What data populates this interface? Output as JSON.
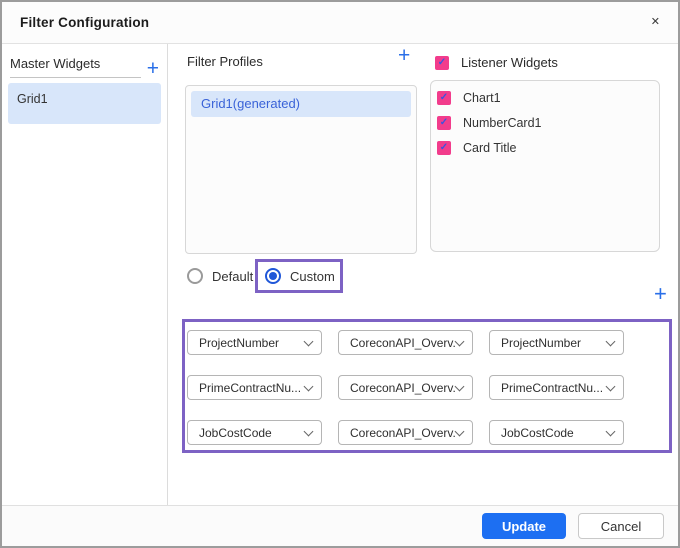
{
  "dialog": {
    "title": "Filter Configuration"
  },
  "icons": {
    "close": "✕",
    "plus": "+",
    "check": "✓"
  },
  "master_widgets": {
    "header": "Master Widgets",
    "items": [
      {
        "label": "Grid1",
        "selected": true
      }
    ]
  },
  "filter_profiles": {
    "header": "Filter Profiles",
    "items": [
      {
        "label": "Grid1(generated)",
        "selected": true
      }
    ]
  },
  "listener_widgets": {
    "header": "Listener Widgets",
    "header_checked": true,
    "items": [
      {
        "label": "Chart1",
        "checked": true
      },
      {
        "label": "NumberCard1",
        "checked": true
      },
      {
        "label": "Card Title",
        "checked": true
      }
    ]
  },
  "filter_mode": {
    "options": [
      {
        "label": "Default",
        "selected": false
      },
      {
        "label": "Custom",
        "selected": true,
        "highlighted": true
      }
    ]
  },
  "mappings": {
    "rows": [
      {
        "field": "ProjectNumber",
        "source": "CoreconAPI_Overv...",
        "target": "ProjectNumber"
      },
      {
        "field": "PrimeContractNu...",
        "source": "CoreconAPI_Overv...",
        "target": "PrimeContractNu..."
      },
      {
        "field": "JobCostCode",
        "source": "CoreconAPI_Overv...",
        "target": "JobCostCode"
      }
    ]
  },
  "footer": {
    "update_label": "Update",
    "cancel_label": "Cancel"
  },
  "colors": {
    "accent_blue": "#2a6fe8",
    "selected_bg": "#d8e6fa",
    "selected_text": "#3a63d8",
    "checkbox_pink": "#f23c8c",
    "checkmark_blue": "#3c55dd",
    "annotation_purple": "#7d62c4",
    "update_button_blue": "#1d6ff2"
  }
}
